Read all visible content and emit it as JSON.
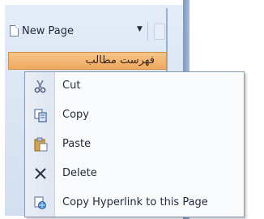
{
  "pane": {
    "new_page_label": "New Page",
    "current_page_label": "فهرست مطالب"
  },
  "context_menu": {
    "items": [
      {
        "label": "Cut",
        "icon": "scissors-icon"
      },
      {
        "label": "Copy",
        "icon": "copy-icon"
      },
      {
        "label": "Paste",
        "icon": "paste-icon"
      },
      {
        "label": "Delete",
        "icon": "delete-icon"
      },
      {
        "label": "Copy Hyperlink to this Page",
        "icon": "hyperlink-icon"
      }
    ]
  }
}
